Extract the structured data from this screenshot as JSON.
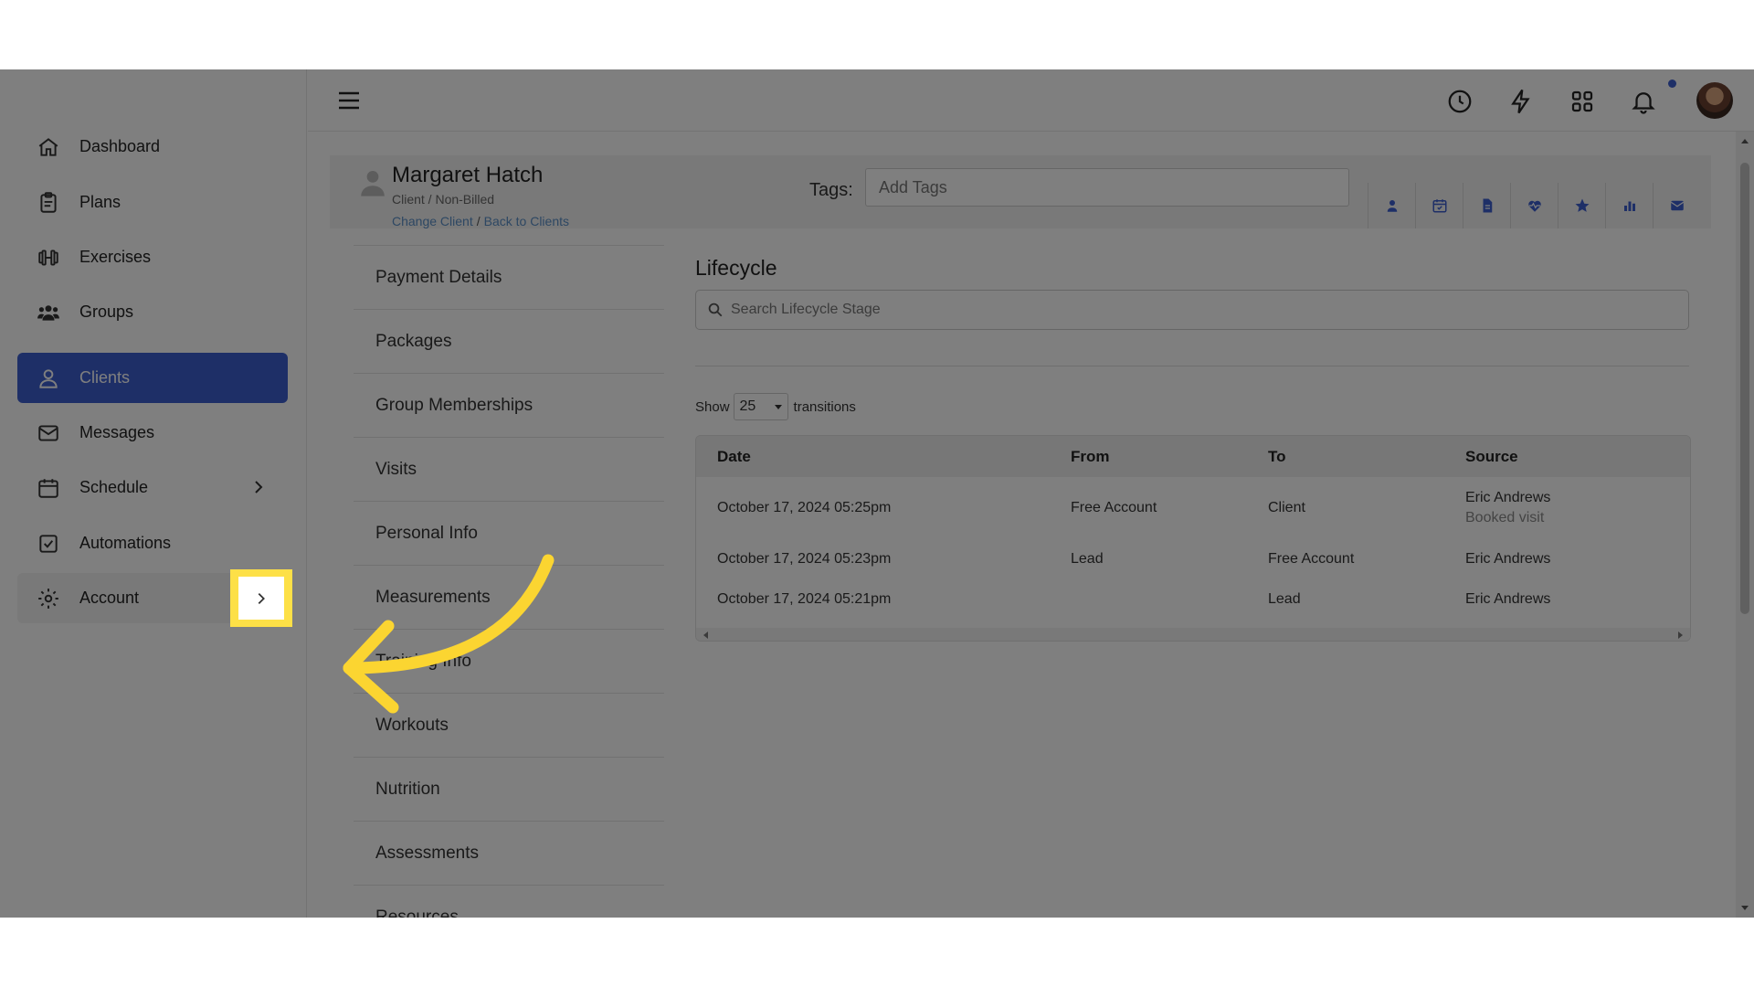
{
  "sidebar": {
    "items": [
      {
        "label": "Dashboard",
        "icon": "home-icon"
      },
      {
        "label": "Plans",
        "icon": "clipboard-icon"
      },
      {
        "label": "Exercises",
        "icon": "dumbbell-icon"
      },
      {
        "label": "Groups",
        "icon": "users-icon"
      },
      {
        "label": "Clients",
        "icon": "user-icon",
        "active": true
      },
      {
        "label": "Messages",
        "icon": "envelope-icon"
      },
      {
        "label": "Schedule",
        "icon": "calendar-icon"
      },
      {
        "label": "Automations",
        "icon": "checkbox-icon"
      },
      {
        "label": "Account",
        "icon": "gear-icon"
      }
    ],
    "accent_color": "#3d5fcf"
  },
  "topbar": {
    "icons": [
      "menu-icon",
      "clock-icon",
      "bolt-icon",
      "apps-icon",
      "bell-icon",
      "avatar"
    ]
  },
  "client": {
    "name": "Margaret Hatch",
    "subtitle": "Client / Non-Billed",
    "change_link": "Change Client",
    "separator": "/",
    "back_link": "Back to Clients",
    "tags_label": "Tags:",
    "tags_placeholder": "Add Tags",
    "action_icons": [
      "profile-icon",
      "calendar-check-icon",
      "document-icon",
      "heartbeat-icon",
      "star-icon",
      "bar-chart-icon",
      "envelope-icon"
    ]
  },
  "submenu": {
    "items": [
      "Payment Details",
      "Packages",
      "Group Memberships",
      "Visits",
      "Personal Info",
      "Measurements",
      "Training Info",
      "Workouts",
      "Nutrition",
      "Assessments",
      "Resources"
    ]
  },
  "lifecycle": {
    "title": "Lifecycle",
    "search_placeholder": "Search Lifecycle Stage",
    "show_label": "Show",
    "page_size": "25",
    "transitions_label": "transitions",
    "columns": [
      "Date",
      "From",
      "To",
      "Source"
    ],
    "rows": [
      {
        "date": "October 17, 2024 05:25pm",
        "from": "Free Account",
        "to": "Client",
        "source": "Eric Andrews",
        "source_sub": "Booked visit"
      },
      {
        "date": "October 17, 2024 05:23pm",
        "from": "Lead",
        "to": "Free Account",
        "source": "Eric Andrews",
        "source_sub": ""
      },
      {
        "date": "October 17, 2024 05:21pm",
        "from": "",
        "to": "Lead",
        "source": "Eric Andrews",
        "source_sub": ""
      }
    ]
  },
  "annotation": {
    "highlight_color": "#fde047",
    "arrow_color": "#fbd531"
  }
}
